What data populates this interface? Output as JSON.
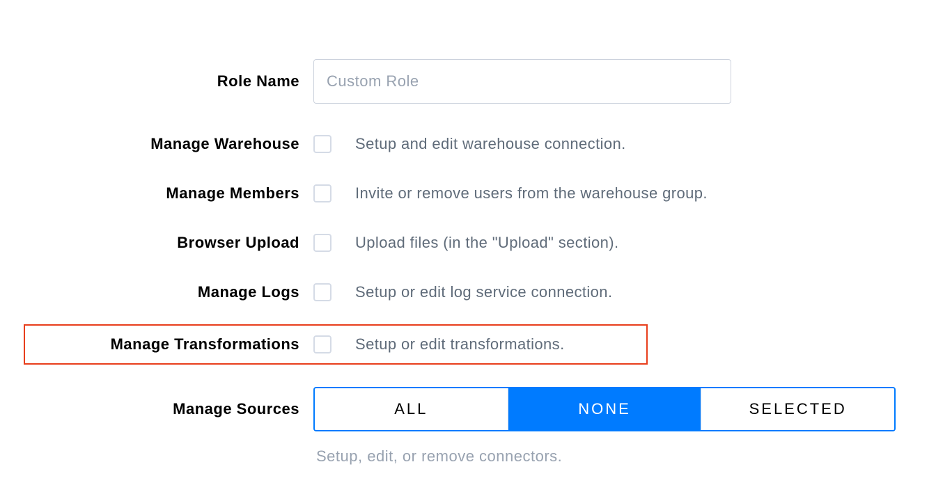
{
  "roleName": {
    "label": "Role Name",
    "placeholder": "Custom Role",
    "value": ""
  },
  "rows": {
    "manageWarehouse": {
      "label": "Manage Warehouse",
      "desc": "Setup and edit warehouse connection."
    },
    "manageMembers": {
      "label": "Manage Members",
      "desc": "Invite or remove users from the warehouse group."
    },
    "browserUpload": {
      "label": "Browser Upload",
      "desc": "Upload files (in the \"Upload\" section)."
    },
    "manageLogs": {
      "label": "Manage Logs",
      "desc": "Setup or edit log service connection."
    },
    "manageTransformations": {
      "label": "Manage Transformations",
      "desc": "Setup or edit transformations."
    }
  },
  "manageSources": {
    "label": "Manage Sources",
    "options": {
      "all": "ALL",
      "none": "NONE",
      "selected": "SELECTED"
    },
    "active": "none",
    "desc": "Setup, edit, or remove connectors."
  }
}
